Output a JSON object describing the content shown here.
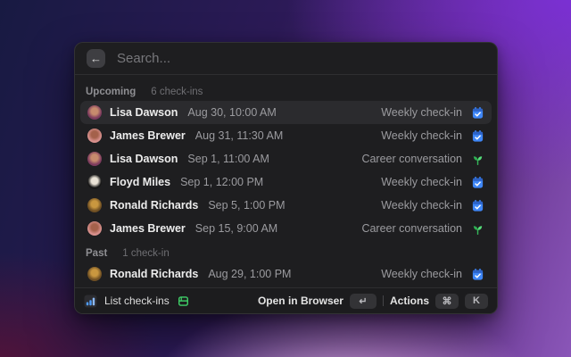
{
  "search": {
    "placeholder": "Search...",
    "back_icon": "arrow-left-icon"
  },
  "colors": {
    "accent_blue": "#3e86f6",
    "accent_green": "#3fd068",
    "selection_bg": "#2b2b2e",
    "window_bg": "#1e1e20"
  },
  "sections": [
    {
      "label": "Upcoming",
      "count": "6 check-ins",
      "rows": [
        {
          "name": "Lisa Dawson",
          "date": "Aug 30, 10:00 AM",
          "type": "Weekly check-in",
          "icon": "calendar-check",
          "avatar": {
            "outer": "#7e3b5e",
            "inner": "#c78b6d"
          }
        },
        {
          "name": "James Brewer",
          "date": "Aug 31, 11:30 AM",
          "type": "Weekly check-in",
          "icon": "calendar-check",
          "avatar": {
            "outer": "#d8908d",
            "inner": "#a4614b"
          }
        },
        {
          "name": "Lisa Dawson",
          "date": "Sep 1, 11:00 AM",
          "type": "Career conversation",
          "icon": "sprout",
          "avatar": {
            "outer": "#7e3b5e",
            "inner": "#c78b6d"
          }
        },
        {
          "name": "Floyd Miles",
          "date": "Sep 1, 12:00 PM",
          "type": "Weekly check-in",
          "icon": "calendar-check",
          "avatar": {
            "outer": "#161616",
            "inner": "#e9e2d6"
          }
        },
        {
          "name": "Ronald Richards",
          "date": "Sep 5, 1:00 PM",
          "type": "Weekly check-in",
          "icon": "calendar-check",
          "avatar": {
            "outer": "#6f4f23",
            "inner": "#c9973f"
          }
        },
        {
          "name": "James Brewer",
          "date": "Sep 15, 9:00 AM",
          "type": "Career conversation",
          "icon": "sprout",
          "avatar": {
            "outer": "#d8908d",
            "inner": "#a4614b"
          }
        }
      ]
    },
    {
      "label": "Past",
      "count": "1 check-in",
      "rows": [
        {
          "name": "Ronald Richards",
          "date": "Aug 29, 1:00 PM",
          "type": "Weekly check-in",
          "icon": "calendar-check",
          "avatar": {
            "outer": "#6f4f23",
            "inner": "#c9973f"
          }
        }
      ]
    }
  ],
  "footer": {
    "command_icon": "bar-chart-icon",
    "command_label": "List check-ins",
    "extension_icon": "lattice-logo-icon",
    "primary_action": "Open in Browser",
    "primary_key": "↵",
    "actions_label": "Actions",
    "actions_keys": [
      "⌘",
      "K"
    ]
  }
}
